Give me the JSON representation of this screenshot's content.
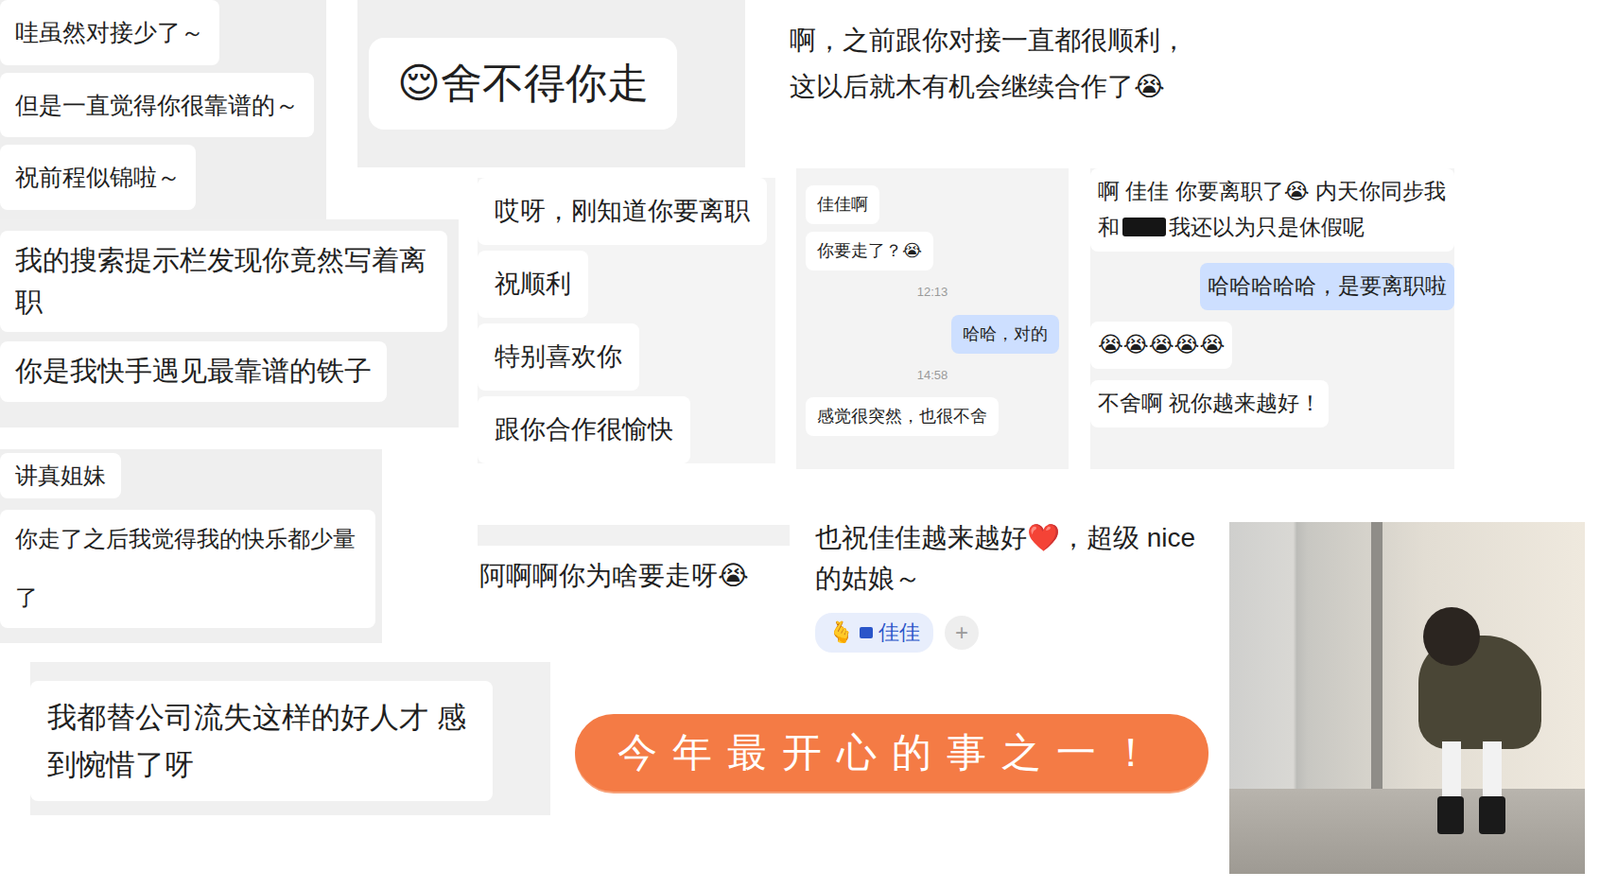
{
  "cards": [
    {
      "kind": "stack",
      "messages": [
        {
          "kind": "incoming",
          "text": "哇虽然对接少了～"
        },
        {
          "kind": "incoming",
          "text": "但是一直觉得你很靠谱的～"
        },
        {
          "kind": "incoming",
          "text": "祝前程似锦啦～"
        }
      ]
    },
    {
      "kind": "stack",
      "messages": [
        {
          "kind": "incoming",
          "text": "😌舍不得你走"
        }
      ]
    },
    {
      "kind": "plain",
      "messages": [
        {
          "kind": "plain",
          "text": "啊，之前跟你对接一直都很顺利，这以后就木有机会继续合作了😭"
        }
      ]
    },
    {
      "kind": "stack",
      "messages": [
        {
          "kind": "incoming",
          "text": "我的搜索提示栏发现你竟然写着离职"
        },
        {
          "kind": "incoming",
          "text": "你是我快手遇见最靠谱的铁子"
        }
      ]
    },
    {
      "kind": "stack",
      "messages": [
        {
          "kind": "incoming",
          "text": "讲真姐妹"
        },
        {
          "kind": "incoming",
          "text": "你走了之后我觉得我的快乐都少量了"
        }
      ]
    },
    {
      "kind": "stack",
      "messages": [
        {
          "kind": "incoming",
          "text": "哎呀，刚知道你要离职"
        },
        {
          "kind": "incoming",
          "text": "祝顺利"
        },
        {
          "kind": "incoming",
          "text": "特别喜欢你"
        },
        {
          "kind": "incoming",
          "text": "跟你合作很愉快"
        }
      ]
    },
    {
      "kind": "chat",
      "messages": [
        {
          "kind": "incoming",
          "text": "佳佳啊"
        },
        {
          "kind": "incoming",
          "text": "你要走了？😭"
        },
        {
          "kind": "time",
          "text": "12:13"
        },
        {
          "kind": "outgoing",
          "text": "哈哈，对的"
        },
        {
          "kind": "time",
          "text": "14:58"
        },
        {
          "kind": "incoming",
          "text": "感觉很突然，也很不舍"
        }
      ]
    },
    {
      "kind": "chat",
      "messages": [
        {
          "kind": "incoming",
          "segments": [
            "啊 佳佳 你要离职了😭 内天你同步我和",
            "我还以为只是休假呢"
          ]
        },
        {
          "kind": "outgoing",
          "text": "哈哈哈哈哈，是要离职啦"
        },
        {
          "kind": "incoming",
          "text": "😭😭😭😭😭"
        },
        {
          "kind": "incoming",
          "text": "不舍啊  祝你越来越好！"
        }
      ]
    },
    {
      "kind": "plain",
      "messages": [
        {
          "kind": "plain",
          "text": "阿啊啊你为啥要走呀😭"
        }
      ]
    },
    {
      "kind": "reaction",
      "messages": [
        {
          "kind": "plain",
          "text": "也祝佳佳越来越好❤️，超级 nice 的姑娘～"
        }
      ],
      "reaction": {
        "icon": "🫰",
        "name": "佳佳"
      },
      "add": "+"
    },
    {
      "kind": "stack",
      "messages": [
        {
          "kind": "incoming",
          "text": "我都替公司流失这样的好人才 感到惋惜了呀"
        }
      ]
    }
  ],
  "banner": {
    "text": "今年最开心的事之一！"
  },
  "photo": {
    "kind": "meme"
  }
}
